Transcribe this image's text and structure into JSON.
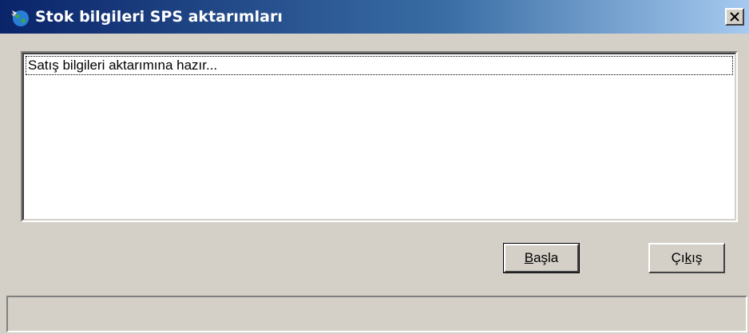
{
  "window": {
    "title": "Stok bilgileri SPS aktarımları",
    "icon": "globe-app-icon",
    "close_glyph": "×"
  },
  "log": {
    "lines": [
      "Satış bilgileri aktarımına hazır..."
    ]
  },
  "buttons": {
    "start": {
      "label_mnemonic": "B",
      "label_rest": "aşla",
      "full": "Başla"
    },
    "exit": {
      "label_pre": "Çı",
      "label_mnemonic": "k",
      "label_rest": "ış",
      "full": "Çıkış"
    }
  },
  "statusbar": {
    "text": ""
  },
  "colors": {
    "title_gradient_start": "#0a246a",
    "title_gradient_end": "#a6caf0",
    "face": "#d4d0c8"
  }
}
